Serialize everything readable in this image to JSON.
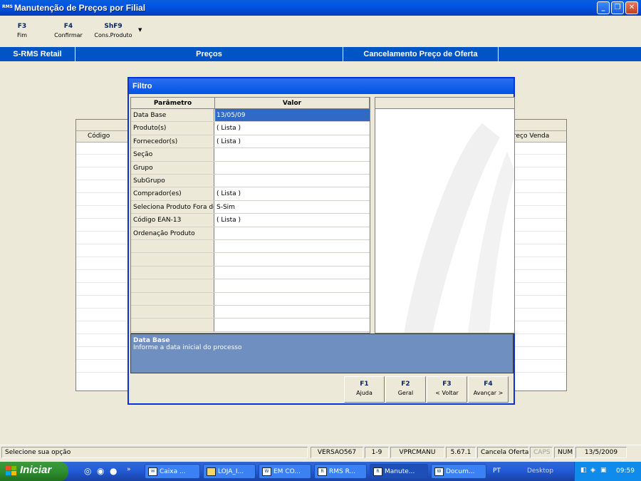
{
  "window": {
    "app_icon": "RMS",
    "title": "Manutenção de Preços por Filial"
  },
  "toolbar": [
    {
      "key": "F3",
      "label": "Fim"
    },
    {
      "key": "F4",
      "label": "Confirmar"
    },
    {
      "key": "ShF9",
      "label": "Cons.Produto"
    }
  ],
  "strip": {
    "left": "S-RMS Retail",
    "center": "Preços",
    "right": "Cancelamento Preço de Oferta"
  },
  "bggrid": {
    "col_codigo": "Código",
    "col_preco": "reço Venda"
  },
  "dialog": {
    "title": "Filtro",
    "col_parametro": "Parâmetro",
    "col_valor": "Valor",
    "rows": [
      {
        "param": "Data Base",
        "value": "13/05/09"
      },
      {
        "param": "Produto(s)",
        "value": "( Lista )"
      },
      {
        "param": "Fornecedor(s)",
        "value": "( Lista )"
      },
      {
        "param": "Seção",
        "value": ""
      },
      {
        "param": "Grupo",
        "value": ""
      },
      {
        "param": "SubGrupo",
        "value": ""
      },
      {
        "param": "Comprador(es)",
        "value": "( Lista )"
      },
      {
        "param": "Seleciona Produto Fora de",
        "value": "S-Sim"
      },
      {
        "param": "Código EAN-13",
        "value": "( Lista )"
      },
      {
        "param": "Ordenação Produto",
        "value": ""
      },
      {
        "param": "",
        "value": ""
      },
      {
        "param": "",
        "value": ""
      },
      {
        "param": "",
        "value": ""
      },
      {
        "param": "",
        "value": ""
      },
      {
        "param": "",
        "value": ""
      },
      {
        "param": "",
        "value": ""
      },
      {
        "param": "",
        "value": ""
      }
    ],
    "help_title": "Data Base",
    "help_text": "Informe a data inicial do processo",
    "buttons": [
      {
        "key": "F1",
        "label": "Ajuda"
      },
      {
        "key": "F2",
        "label": "Geral"
      },
      {
        "key": "F3",
        "label": "< Voltar"
      },
      {
        "key": "F4",
        "label": "Avançar >"
      }
    ]
  },
  "status": {
    "message": "Selecione sua opção",
    "version": "VERSAO567",
    "page": "1-9",
    "program": "VPRCMANU",
    "build": "5.67.1",
    "mode": "Cancela Oferta",
    "caps": "CAPS",
    "num": "NUM",
    "date": "13/5/2009"
  },
  "taskbar": {
    "start": "Iniciar",
    "tasks": [
      "Caixa ...",
      "LOJA_I...",
      "EM CO...",
      "RMS R...",
      "Manute...",
      "Docum..."
    ],
    "lang": "PT",
    "desktop": "Desktop",
    "clock": "09:59"
  }
}
